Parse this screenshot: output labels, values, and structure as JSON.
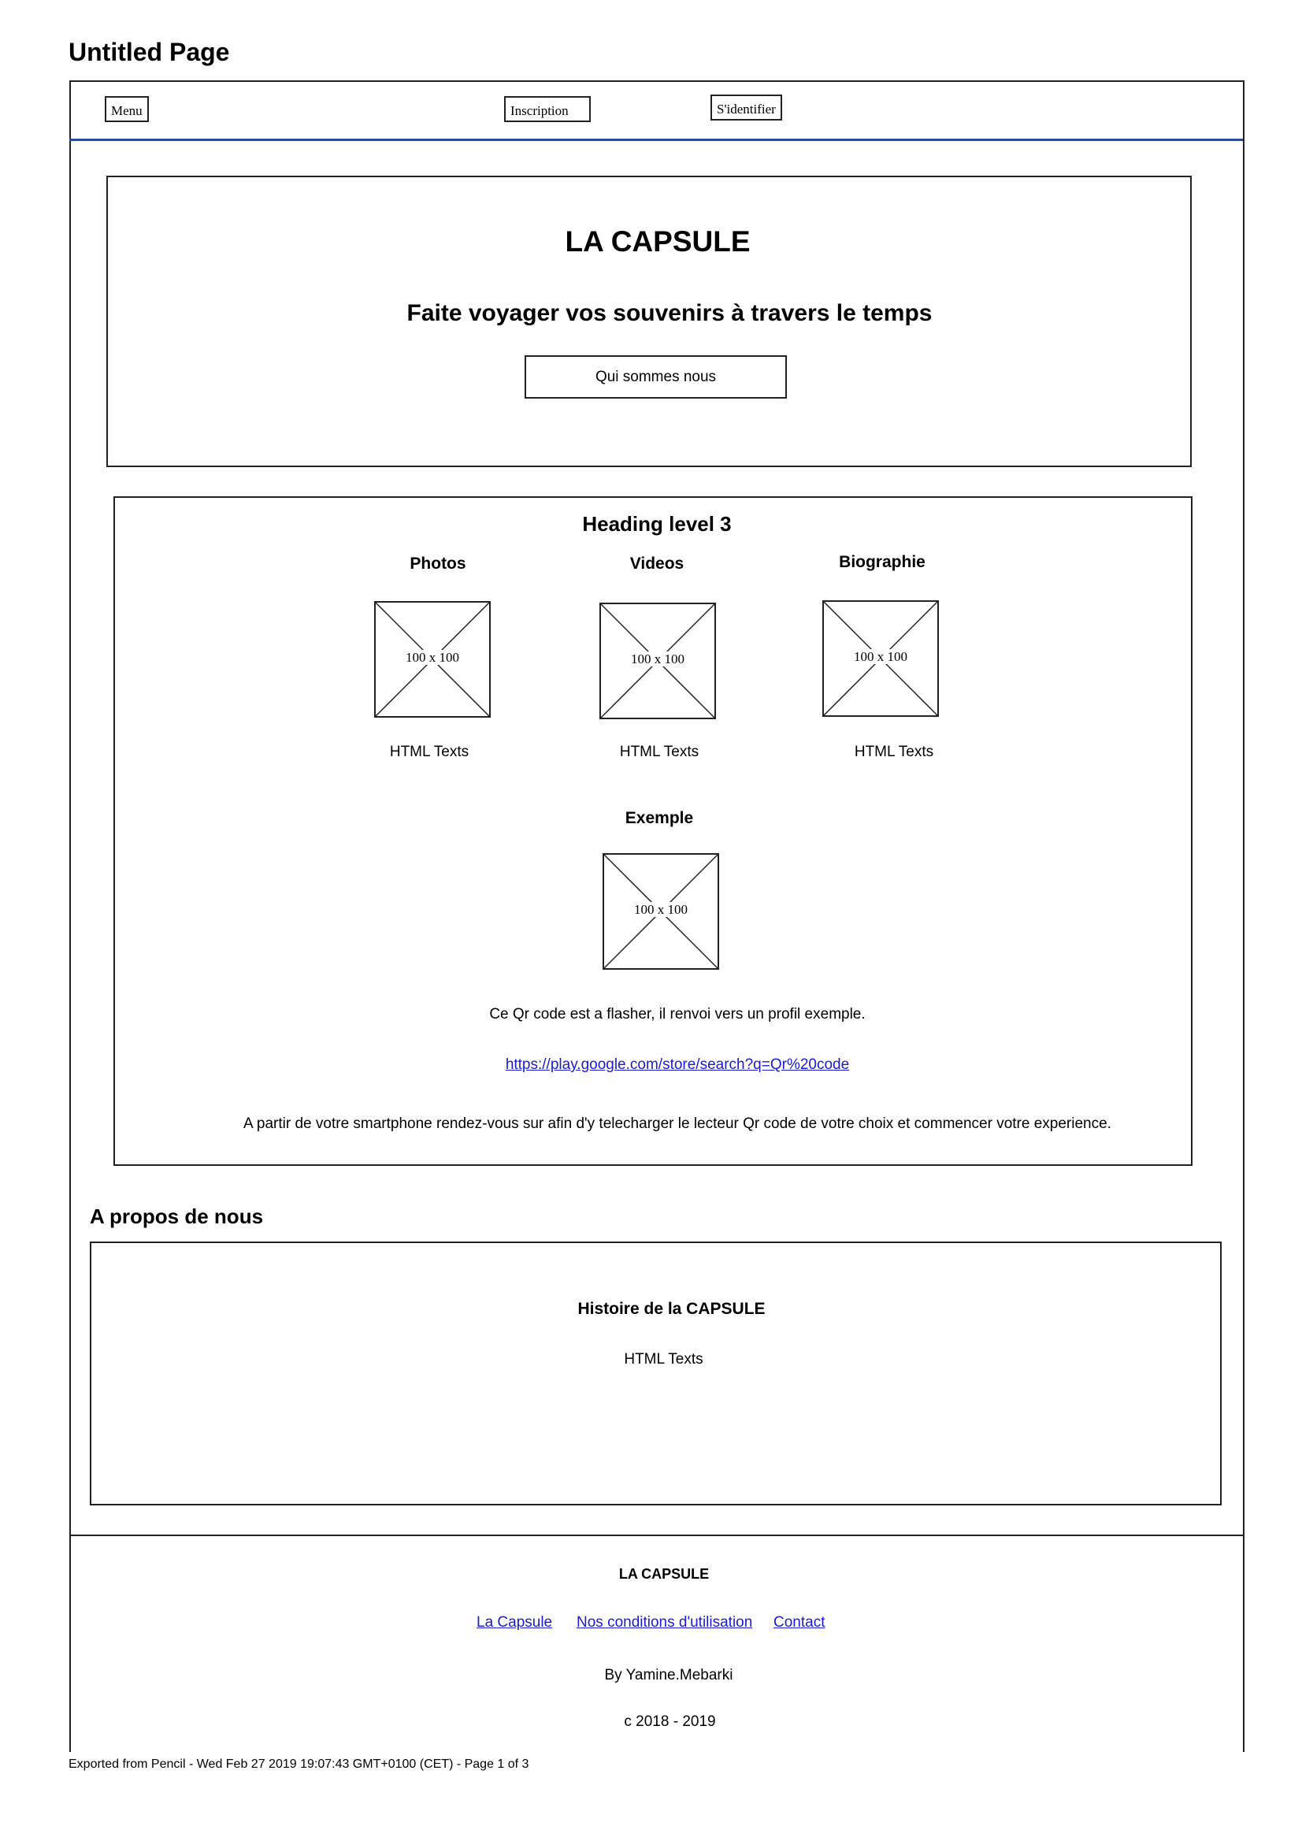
{
  "page": {
    "title": "Untitled Page"
  },
  "nav": {
    "menu": "Menu",
    "inscription": "Inscription",
    "login": "S'identifier"
  },
  "hero": {
    "title": "LA CAPSULE",
    "subtitle": "Faite voyager vos souvenirs à travers le temps",
    "button": "Qui sommes nous"
  },
  "section": {
    "heading": "Heading level 3",
    "columns": [
      {
        "title": "Photos",
        "image": "100 x 100",
        "text": "HTML Texts"
      },
      {
        "title": "Videos",
        "image": "100 x 100",
        "text": "HTML Texts"
      },
      {
        "title": "Biographie",
        "image": "100 x 100",
        "text": "HTML Texts"
      }
    ],
    "example": {
      "title": "Exemple",
      "image": "100 x 100",
      "caption": "Ce Qr code est a flasher, il renvoi vers un profil exemple.",
      "link": "https://play.google.com/store/search?q=Qr%20code",
      "info": "A partir de votre smartphone rendez-vous sur afin d'y telecharger le lecteur Qr code de votre choix et commencer votre experience."
    }
  },
  "about": {
    "heading": "A propos de nous",
    "title": "Histoire de la CAPSULE",
    "text": "HTML Texts"
  },
  "footer": {
    "brand": "LA CAPSULE",
    "links": [
      "La Capsule",
      "Nos conditions d'utilisation",
      "Contact"
    ],
    "author": "By Yamine.Mebarki",
    "copyright": "c 2018 - 2019"
  },
  "export_note": "Exported from Pencil - Wed Feb 27 2019 19:07:43 GMT+0100 (CET) - Page 1 of 3"
}
